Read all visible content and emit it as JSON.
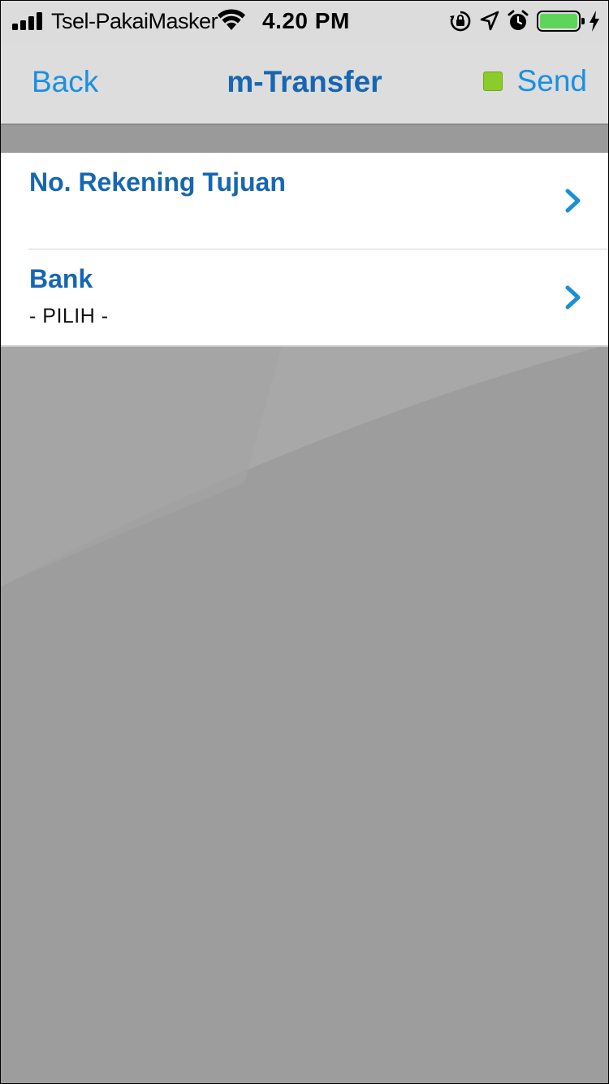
{
  "status_bar": {
    "carrier": "Tsel-PakaiMasker",
    "time": "4.20 PM",
    "battery_level": 1.0,
    "battery_color": "#5ed45a",
    "icons": [
      "signal-icon",
      "wifi-icon",
      "rotation-lock-icon",
      "location-arrow-icon",
      "alarm-icon",
      "battery-icon",
      "charging-bolt-icon"
    ]
  },
  "nav": {
    "back_label": "Back",
    "title": "m-Transfer",
    "send_label": "Send",
    "send_indicator_color": "#8ccc2a"
  },
  "form": {
    "rows": [
      {
        "label": "No. Rekening Tujuan",
        "value": ""
      },
      {
        "label": "Bank",
        "value": "- PILIH -"
      }
    ]
  },
  "colors": {
    "accent": "#1a8fe3",
    "label": "#1766b3",
    "chevron": "#1c8fd6",
    "background": "#9d9d9d"
  }
}
